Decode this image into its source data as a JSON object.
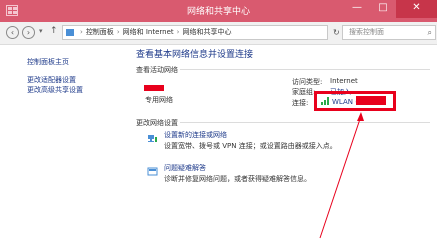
{
  "window": {
    "title": "网络和共享中心",
    "controls": {
      "minimize": "—",
      "maximize": "□",
      "close": "✕"
    }
  },
  "address_bar": {
    "nav_back": "‹",
    "nav_forward": "›",
    "history_arrow": "▾",
    "up": "↑",
    "separator": "›",
    "path": [
      "控制面板",
      "网络和 Internet",
      "网络和共享中心"
    ],
    "dropdown": "▾",
    "refresh": "↻",
    "search_placeholder": "搜索控制面",
    "search_icon": "⌕"
  },
  "sidebar": {
    "items": [
      {
        "label": "控制面板主页"
      },
      {
        "label": "更改适配器设置"
      },
      {
        "label": "更改高级共享设置"
      }
    ]
  },
  "main": {
    "heading": "查看基本网络信息并设置连接",
    "active_networks_label": "查看活动网络",
    "network_type": "专用网络",
    "access_type_label": "访问类型:",
    "access_type_value": "Internet",
    "homegroup_label": "家庭组:",
    "homegroup_value": "已加入",
    "connection_label": "连接:",
    "connection_value": "WLAN (",
    "change_settings_label": "更改网络设置",
    "tasks": [
      {
        "icon": "network-setup-icon",
        "title": "设置新的连接或网络",
        "desc": "设置宽带、拨号或 VPN 连接；或设置路由器或接入点。"
      },
      {
        "icon": "troubleshoot-icon",
        "title": "问题疑难解答",
        "desc": "诊断并修复网络问题，或者获得疑难解答信息。"
      }
    ]
  },
  "colors": {
    "titlebar": "#d95a6f",
    "close_button": "#c7354a",
    "link": "#1e3a8a",
    "annotation_red": "#e8001c",
    "wifi_green": "#2aa84a"
  }
}
